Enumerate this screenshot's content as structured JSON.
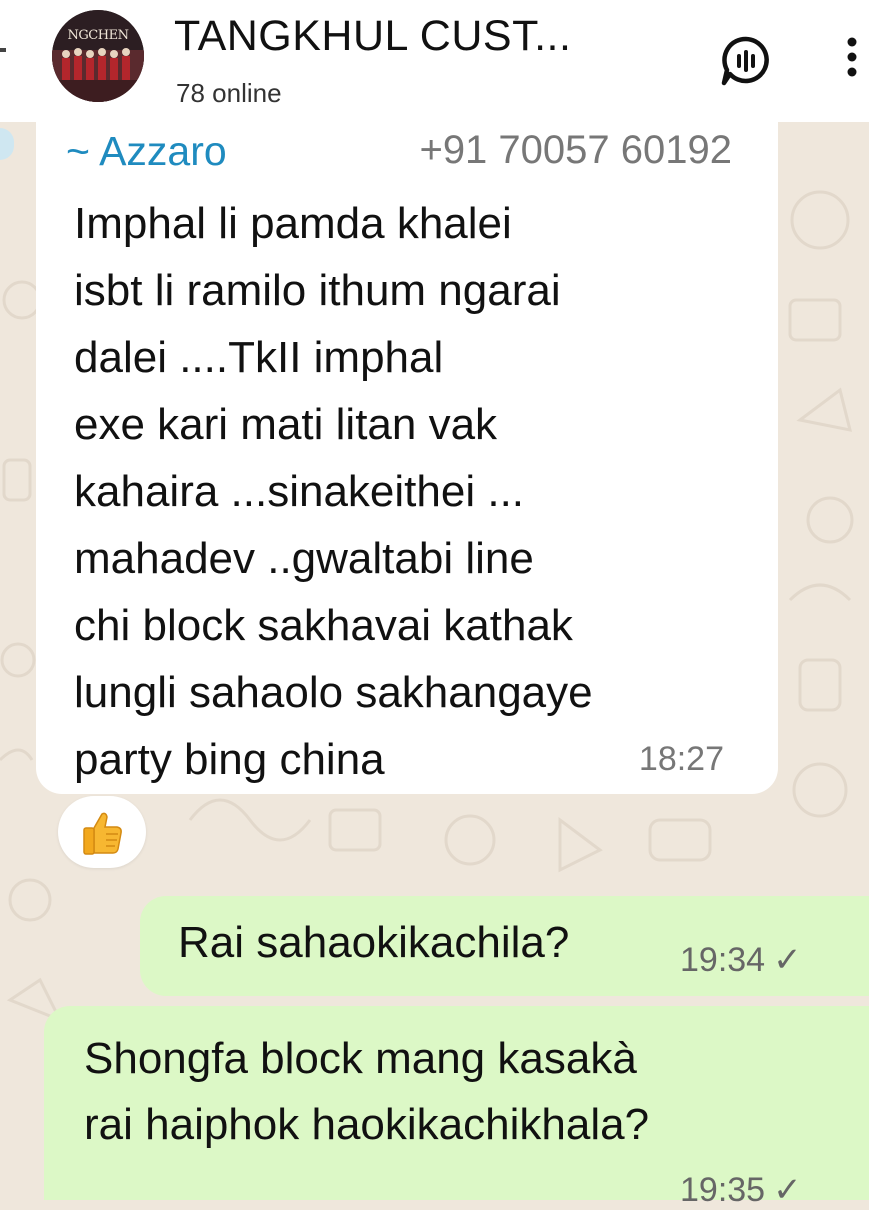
{
  "header": {
    "avatar_text": "NGCHEN",
    "title": "TANGKHUL CUST...",
    "subtitle": "78 online"
  },
  "messages": [
    {
      "direction": "incoming",
      "sender_name": "~ Azzaro",
      "sender_phone": "+91 70057 60192",
      "lines": [
        "Imphal li pamda khalei",
        "isbt li ramilo ithum ngarai",
        "dalei ....TkII imphal",
        "exe kari mati litan vak",
        "kahaira ...sinakeithei ...",
        "mahadev ..gwaltabi line",
        "chi block sakhavai kathak",
        "lungli sahaolo sakhangaye",
        "party bing china"
      ],
      "time": "18:27",
      "reaction": "👍"
    },
    {
      "direction": "outgoing",
      "text": "Rai sahaokikachila?",
      "time": "19:34",
      "status": "✓"
    },
    {
      "direction": "outgoing",
      "lines": [
        "Shongfa block mang kasakà",
        "rai haiphok haokikachikhala?"
      ],
      "time": "19:35",
      "status": "✓"
    }
  ],
  "icons": {
    "voice_chat": "voice-chat-icon",
    "menu": "more-vert-icon",
    "reaction": "thumbs-up-icon"
  },
  "colors": {
    "sender_name": "#1f8bbf",
    "outgoing_bubble": "#dcf8c6",
    "incoming_bubble": "#ffffff",
    "chat_background": "#efe7dc"
  }
}
